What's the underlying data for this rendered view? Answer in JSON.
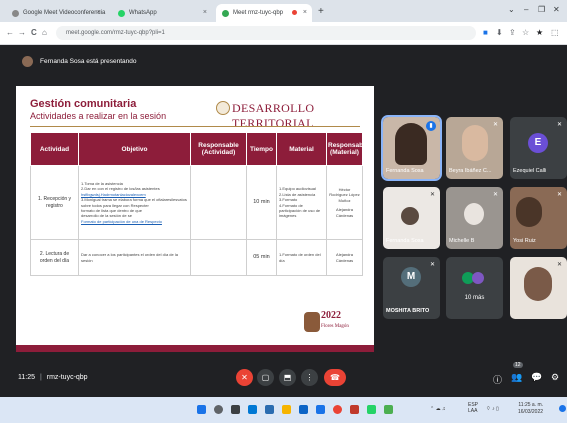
{
  "browser": {
    "tabs": [
      {
        "label": "Google Meet Videoconferencia",
        "favicon_color": "#888888",
        "active": false
      },
      {
        "label": "WhatsApp",
        "favicon_color": "#25d366",
        "active": false
      },
      {
        "label": "Meet rmz-tuyc-qbp",
        "favicon_color": "#34a853",
        "active": true
      }
    ],
    "tab_close": "×",
    "new_tab": "+",
    "window_controls": [
      "⌄",
      "–",
      "❐",
      "✕"
    ],
    "nav": {
      "back": "←",
      "forward": "→",
      "reload": "C",
      "home": "⌂"
    },
    "url": "meet.google.com/rmz-tuyc-qbp?pli=1",
    "right_icons": [
      "■",
      "⬇",
      "⇪",
      "☆",
      "★",
      "⬚"
    ]
  },
  "banner": {
    "text": "Fernanda Sosa está presentando"
  },
  "slide": {
    "title": "Gestión comunitaria",
    "subtitle": "Actividades a realizar en la sesión",
    "brand": "DESARROLLO TERRITORIAL",
    "headers": [
      "Actividad",
      "Objetivo",
      "Responsable (Actividad)",
      "Tiempo",
      "Material",
      "Responsable (Material)"
    ],
    "rows": [
      {
        "actividad": "1. Recepción y registro",
        "objetivo_lines": [
          "1.Toma de la asistencia",
          "2.Dar en con el registro de los/las asistentes",
          "hsfibgwdsj.Hadrmotanlaciovalexcem",
          "3.Monigual trama se elabora forma que el ofialaresilesvatos",
          "sobre todos para llegar con Respecter",
          "formato de lista que dentro de que",
          "desarrollo de la sesión de se"
        ],
        "objetivo_link": "Formato de participación de una de Respecto",
        "responsable_actividad": "",
        "tiempo": "10 min",
        "material_lines": [
          "1.Equipo audiovisual",
          "2.Lista de asistencia",
          "3.Formato",
          "4.Formato de participación de uso de imágenes"
        ],
        "resp_material_lines": [
          "Héctor Rodríguez López",
          "Muñoz",
          "Alejandra Cárdenas"
        ]
      },
      {
        "actividad": "2. Lectura de orden del día",
        "objetivo_lines": [
          "Dar a conocer a los participantes el orden del día de la sesión"
        ],
        "objetivo_link": "",
        "responsable_actividad": "",
        "tiempo": "05 min",
        "material_lines": [
          "1.Formato de orden del día"
        ],
        "resp_material_lines": [
          "Alejandra Cárdenas"
        ]
      }
    ],
    "footer_year": "2022",
    "footer_name": "Flores Magón"
  },
  "participants": [
    {
      "name": "Fernanda Sosa",
      "type": "video",
      "bg": "#c9b7a8",
      "highlighted": true
    },
    {
      "name": "Beyra Ibáñez C...",
      "type": "video",
      "bg": "#b8a796",
      "highlighted": false
    },
    {
      "name": "Ezequiel Calli",
      "type": "avatar",
      "initial": "E",
      "avatar_color": "#6b4fd6",
      "bg": "#3c4043",
      "highlighted": false
    },
    {
      "name": "Fernanda Sosa",
      "type": "video",
      "bg": "#ece8e4",
      "highlighted": false
    },
    {
      "name": "Michelle B",
      "type": "video",
      "bg": "#9a9590",
      "highlighted": false
    },
    {
      "name": "Yosi Ruiz",
      "type": "video",
      "bg": "#8a6a55",
      "highlighted": false
    },
    {
      "name": "MOSHITA BRITO",
      "type": "avatar",
      "initial": "M",
      "avatar_color": "#546e7a",
      "bg": "#3c4043",
      "highlighted": false
    },
    {
      "name": "10 más",
      "type": "more",
      "bg": "#3c4043",
      "highlighted": false
    },
    {
      "name": "",
      "type": "video",
      "bg": "#e9e3dc",
      "highlighted": false
    }
  ],
  "meeting": {
    "time": "11:25",
    "code": "rmz-tuyc-qbp",
    "controls": [
      {
        "name": "mic-off",
        "glyph": "✕",
        "color": "#ea4335"
      },
      {
        "name": "camera",
        "glyph": "▢",
        "color": "#3c4043"
      },
      {
        "name": "present",
        "glyph": "⬒",
        "color": "#3c4043"
      },
      {
        "name": "more",
        "glyph": "⋮",
        "color": "#3c4043"
      },
      {
        "name": "leave-call",
        "glyph": "☎",
        "color": "#ea4335"
      }
    ],
    "right_icons": [
      "ⓘ",
      "👥",
      "💬",
      "⚙"
    ],
    "people_count": "12"
  },
  "taskbar": {
    "tray_left": "ESP LAA",
    "tray_time": "11:25 a. m.",
    "tray_date": "16/03/2022"
  }
}
